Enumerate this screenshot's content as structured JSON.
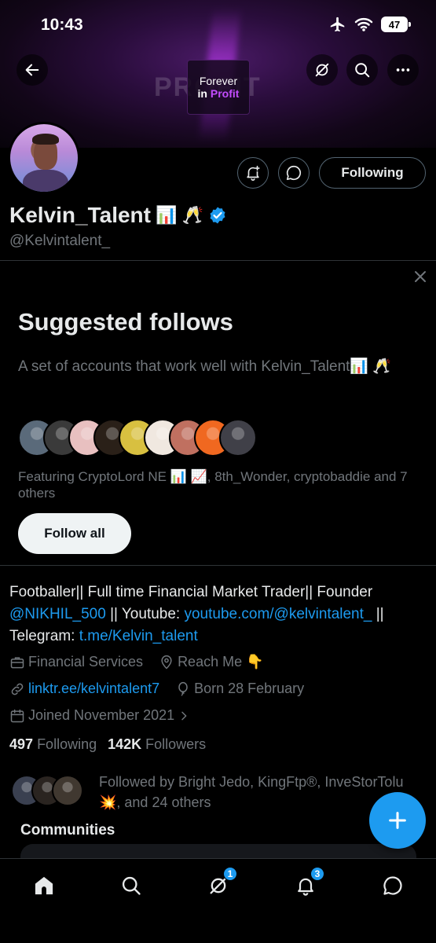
{
  "status_bar": {
    "time": "10:43",
    "battery": "47"
  },
  "banner": {
    "line1": "Forever",
    "line2_a": "in",
    "line2_b": "Profit",
    "ghost_text": "PROFIT"
  },
  "profile": {
    "name": "Kelvin_Talent",
    "name_emoji": "📊 🥂",
    "handle": "@Kelvintalent_",
    "following_button": "Following"
  },
  "suggested": {
    "title": "Suggested follows",
    "description": "A set of accounts that work well with Kelvin_Talent📊 🥂",
    "featuring": "Featuring CryptoLord NE 📊 📈, 8th_Wonder, cryptobaddie and 7 others",
    "follow_all": "Follow all",
    "avatar_colors": [
      "#5a6a7a",
      "#3a3a3a",
      "#e8c0c0",
      "#2a2018",
      "#d8c040",
      "#f0e8e0",
      "#c07060",
      "#f06820",
      "#404048"
    ]
  },
  "bio": {
    "text1": "Footballer|| Full time Financial Market Trader|| Founder ",
    "mention": "@NIKHIL_500",
    "text2": " || Youtube: ",
    "youtube": "youtube.com/@kelvintalent_",
    "text3": " || Telegram: ",
    "telegram": "t.me/Kelvin_talent"
  },
  "meta": {
    "category": "Financial Services",
    "location": "Reach Me 👇",
    "website": "linktr.ee/kelvintalent7",
    "birthday": "Born 28 February",
    "joined": "Joined November 2021"
  },
  "stats": {
    "following_count": "497",
    "following_label": "Following",
    "followers_count": "142K",
    "followers_label": "Followers"
  },
  "followed_by": {
    "text": "Followed by Bright Jedo, KingFtp®, InveStorTolu 💥, and 24 others",
    "avatar_colors": [
      "#3a4050",
      "#2a2420",
      "#403830"
    ]
  },
  "communities": {
    "title": "Communities"
  },
  "tabbar": {
    "grok_badge": "1",
    "notifications_badge": "3"
  },
  "colors": {
    "accent": "#1d9bf0",
    "text": "#e7e9ea",
    "muted": "#71767b"
  }
}
